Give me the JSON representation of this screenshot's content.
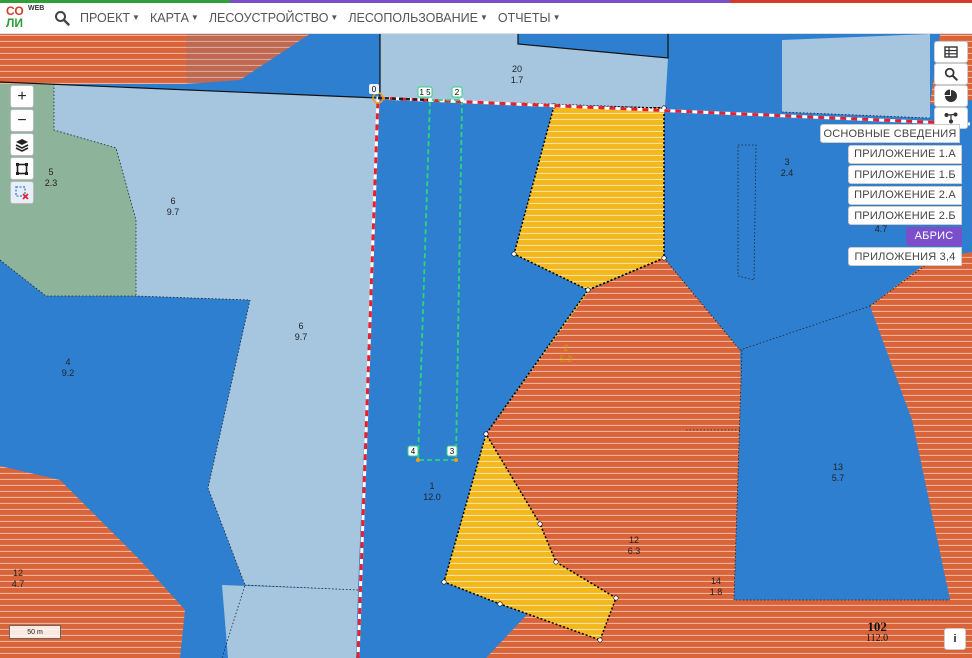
{
  "app": {
    "logo_line1": "СО",
    "logo_line2": "ЛИ",
    "logo_sup": "WEB",
    "colors": {
      "brand_red": "#d33a2a",
      "brand_green": "#2e9d3a",
      "accent_purple": "#7b4fc9",
      "selection_dash": "#e8202a",
      "highlight_green": "#2ad67a"
    }
  },
  "navbar": {
    "search_icon": "search-icon",
    "menus": [
      {
        "label": "ПРОЕКТ"
      },
      {
        "label": "КАРТА"
      },
      {
        "label": "ЛЕСОУСТРОЙСТВО"
      },
      {
        "label": "ЛЕСОПОЛЬЗОВАНИЕ"
      },
      {
        "label": "ОТЧЕТЫ"
      }
    ]
  },
  "map_controls": {
    "zoom_in": "+",
    "zoom_out": "−",
    "icons": [
      "layers-icon",
      "draw-polygon-icon",
      "clear-selection-icon"
    ]
  },
  "right_tools": {
    "icons": [
      "table-icon",
      "search-icon",
      "pie-chart-icon",
      "tree-icon"
    ]
  },
  "tabs": [
    {
      "label": "ОСНОВНЫЕ СВЕДЕНИЯ",
      "active": false
    },
    {
      "label": "ПРИЛОЖЕНИЕ 1.А",
      "active": false
    },
    {
      "label": "ПРИЛОЖЕНИЕ 1.Б",
      "active": false
    },
    {
      "label": "ПРИЛОЖЕНИЕ 2.А",
      "active": false
    },
    {
      "label": "ПРИЛОЖЕНИЕ 2.Б",
      "active": false
    },
    {
      "label": "АБРИС",
      "active": true
    },
    {
      "label": "ПРИЛОЖЕНИЯ 3,4",
      "active": false
    }
  ],
  "map_labels": {
    "l20_num": "20",
    "l20_area": "1.7",
    "l5_num": "5",
    "l5_area": "2.3",
    "l6a_num": "6",
    "l6a_area": "9.7",
    "l6b_num": "6",
    "l6b_area": "9.7",
    "l4_num": "4",
    "l4_area": "9.2",
    "l3_num": "3",
    "l3_area": "2.4",
    "l2_num": "2",
    "l2_area": "5.3",
    "l1_num": "1",
    "l1_area": "12.0",
    "l13_num": "13",
    "l13_area": "5.7",
    "l12a_num": "12",
    "l12a_area": "6.3",
    "l12b_num": "12",
    "l12b_area": "4.7",
    "l14_num": "14",
    "l14_area": "1.8",
    "l47_area": "4.7"
  },
  "points": {
    "p0": "0",
    "p15": "1 5",
    "p2": "2",
    "p4": "4",
    "p3": "3"
  },
  "scale_label": "50 m",
  "quarter": {
    "number": "102",
    "area": "112.0"
  },
  "info_label": "i"
}
